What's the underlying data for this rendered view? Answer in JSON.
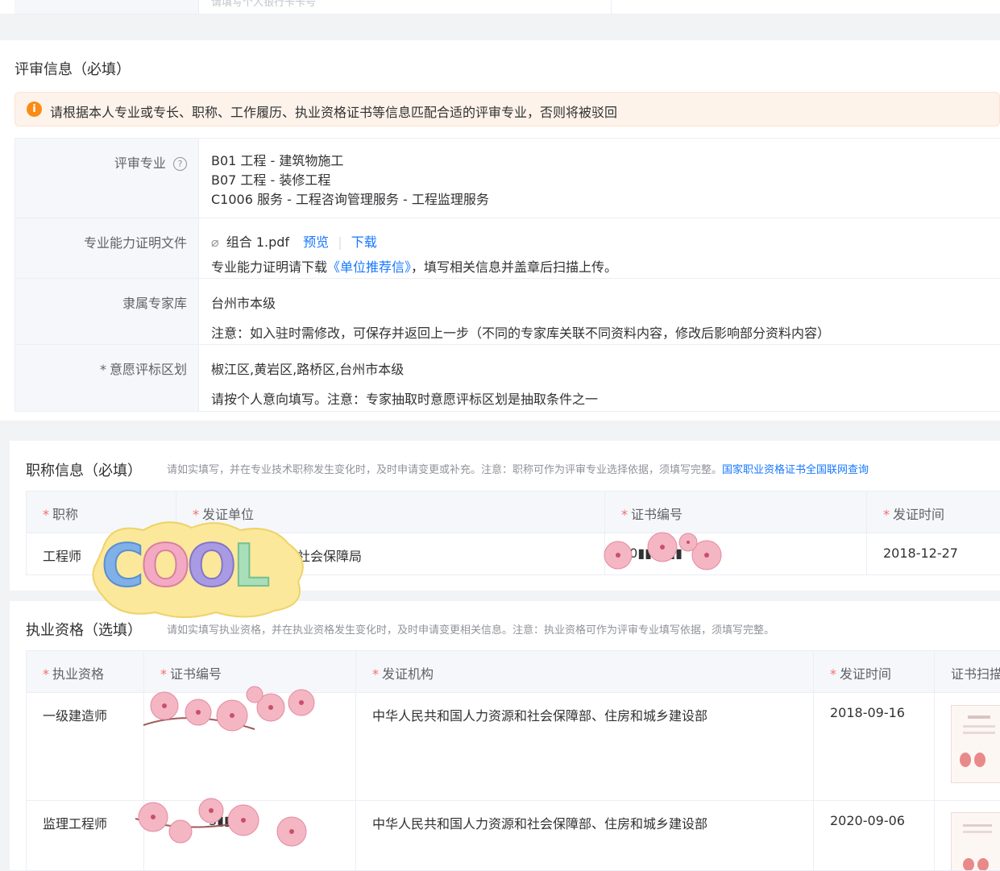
{
  "top_row": {
    "placeholder": "请填写个人银行卡卡号"
  },
  "review": {
    "title": "评审信息（必填）",
    "alert": "请根据本人专业或专长、职称、工作履历、执业资格证书等信息匹配合适的评审专业，否则将被驳回",
    "specialty_label": "评审专业",
    "specialties": [
      "B01 工程 - 建筑物施工",
      "B07 工程 - 装修工程",
      "C1006 服务 - 工程咨询管理服务 - 工程监理服务"
    ],
    "proof_label": "专业能力证明文件",
    "proof_file": "组合 1.pdf",
    "preview": "预览",
    "download": "下载",
    "proof_hint_prefix": "专业能力证明请下载",
    "proof_hint_link": "《单位推荐信》",
    "proof_hint_suffix": "，填写相关信息并盖章后扫描上传。",
    "library_label": "隶属专家库",
    "library_value": "台州市本级",
    "library_hint": "注意：如入驻时需修改，可保存并返回上一步（不同的专家库关联不同资料内容，修改后影响部分资料内容）",
    "region_label": "意愿评标区划",
    "region_value": "椒江区,黄岩区,路桥区,台州市本级",
    "region_hint": "请按个人意向填写。注意：专家抽取时意愿评标区划是抽取条件之一"
  },
  "title_info": {
    "title": "职称信息（必填）",
    "hint": "请如实填写，并在专业技术职称发生变化时，及时申请变更或补充。注意：职称可作为评审专业选择依据，须填写完整。",
    "link": "国家职业资格证书全国联网查询",
    "headers": [
      "职称",
      "发证单位",
      "证书编号",
      "发证时间"
    ],
    "row": {
      "title": "工程师",
      "issuer_visible": "社会保障局",
      "cert_no": "30▮▮06▮▮",
      "date": "2018-12-27"
    }
  },
  "qualification": {
    "title": "执业资格（选填）",
    "hint": "请如实填写执业资格，并在执业资格发生变化时，及时申请变更相关信息。注意：执业资格可作为评审专业填写依据，须填写完整。",
    "headers": [
      "执业资格",
      "证书编号",
      "发证机构",
      "发证时间",
      "证书扫描"
    ],
    "rows": [
      {
        "qual": "一级建造师",
        "cert_no": "",
        "issuer": "中华人民共和国人力资源和社会保障部、住房和城乡建设部",
        "date": "2018-09-16"
      },
      {
        "qual": "监理工程师",
        "cert_no": "3▮▮0▮",
        "issuer": "中华人民共和国人力资源和社会保障部、住房和城乡建设部",
        "date": "2020-09-06"
      }
    ]
  },
  "sticker": {
    "text": "COOL"
  },
  "colors": {
    "link": "#1677ff",
    "alert_bg": "#fef3ea",
    "alert_icon": "#fa8c16",
    "required": "#f56c6c"
  }
}
